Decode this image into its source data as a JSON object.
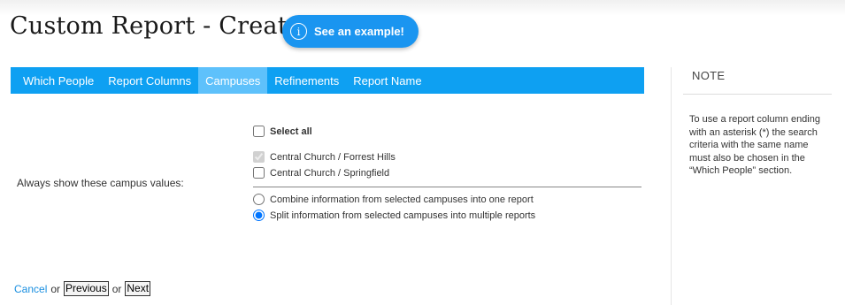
{
  "header": {
    "title": "Custom Report - Create",
    "example_button": {
      "icon": "info-icon",
      "label": "See an example!"
    }
  },
  "tabs": [
    {
      "label": "Which People",
      "active": false
    },
    {
      "label": "Report Columns",
      "active": false
    },
    {
      "label": "Campuses",
      "active": true
    },
    {
      "label": "Refinements",
      "active": false
    },
    {
      "label": "Report Name",
      "active": false
    }
  ],
  "campuses": {
    "field_label": "Always show these campus values:",
    "select_all": {
      "label": "Select all",
      "checked": false
    },
    "options": [
      {
        "label": "Central Church / Forrest Hills",
        "checked": true,
        "disabled": true
      },
      {
        "label": "Central Church / Springfield",
        "checked": false,
        "disabled": false
      }
    ],
    "report_modes": [
      {
        "label": "Combine information from selected campuses into one report",
        "selected": false
      },
      {
        "label": "Split information from selected campuses into multiple reports",
        "selected": true
      }
    ]
  },
  "navigation": {
    "cancel": "Cancel",
    "or": "or",
    "previous": "Previous",
    "next": "Next"
  },
  "note": {
    "title": "NOTE",
    "text": "To use a report column ending with an asterisk (*) the search criteria with the same name must also be chosen in the “Which People” section."
  },
  "colors": {
    "tab_bar": "#0ea0f2",
    "tab_active": "#5ec1fb",
    "example_button": "#1a95f0",
    "link": "#1a8fe0"
  }
}
